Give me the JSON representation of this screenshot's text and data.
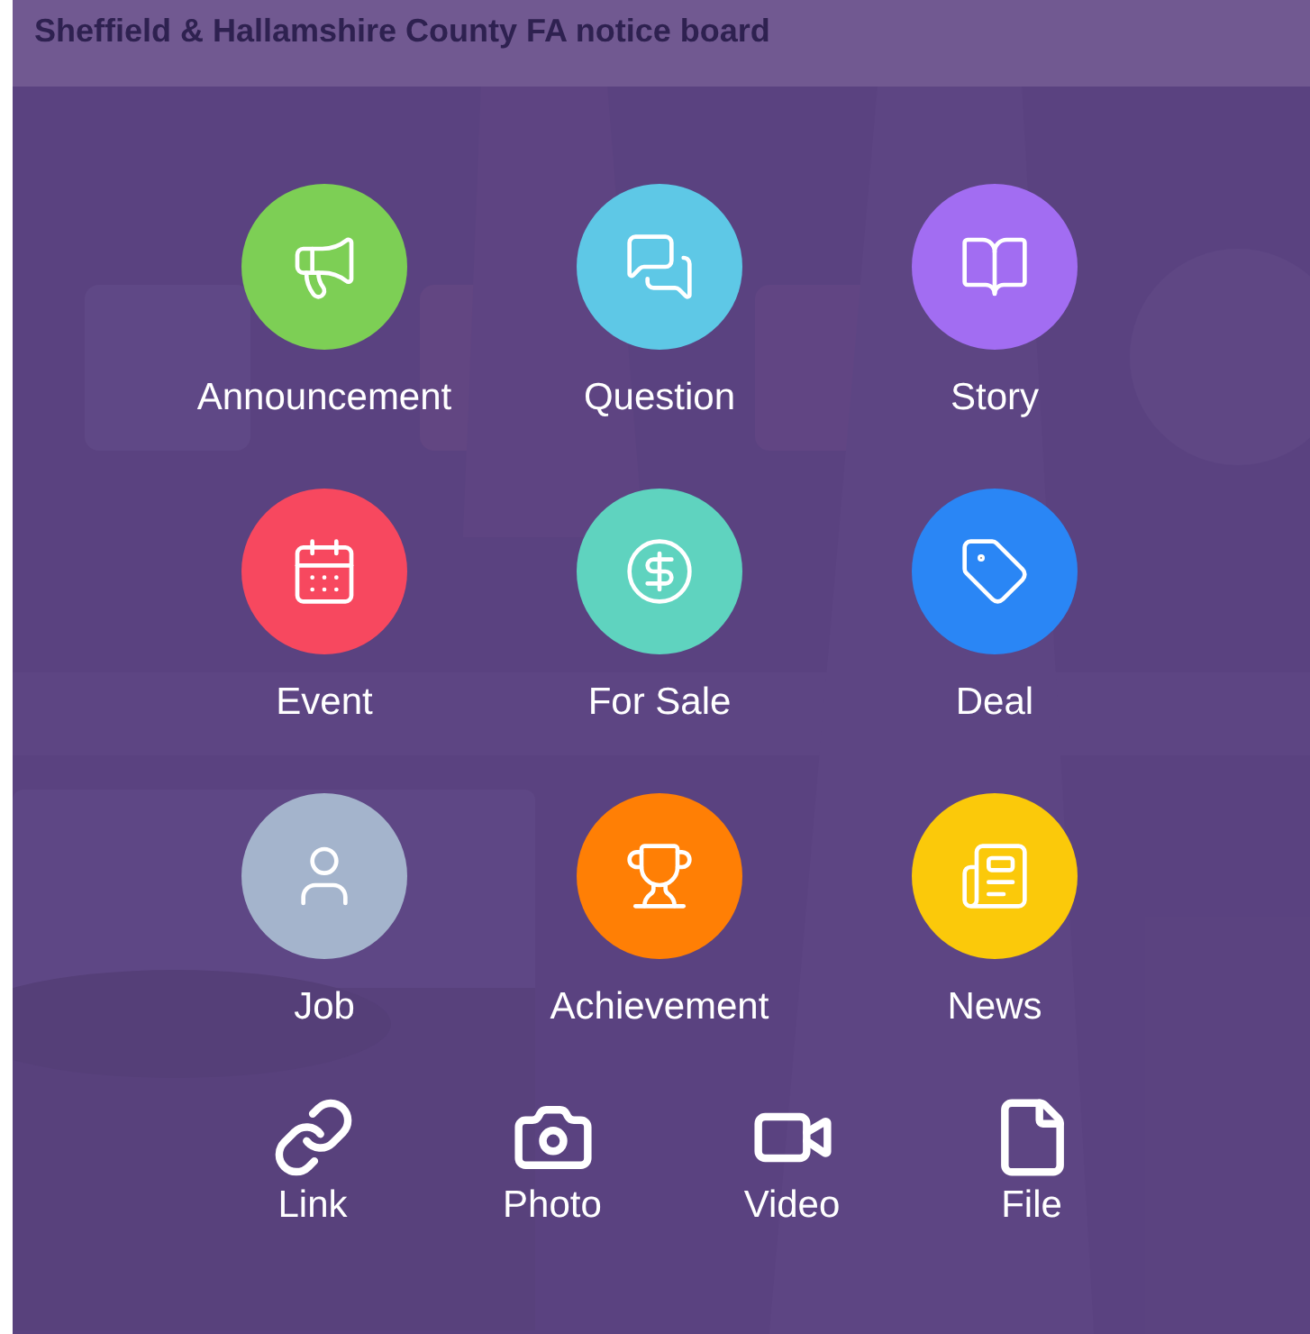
{
  "header": {
    "title": "Sheffield & Hallamshire County FA notice board"
  },
  "post_types": [
    {
      "label": "Announcement",
      "color": "#7dcf55"
    },
    {
      "label": "Question",
      "color": "#5ec8e6"
    },
    {
      "label": "Story",
      "color": "#a26df2"
    },
    {
      "label": "Event",
      "color": "#f7485f"
    },
    {
      "label": "For Sale",
      "color": "#5fd3bf"
    },
    {
      "label": "Deal",
      "color": "#2a86f5"
    },
    {
      "label": "Job",
      "color": "#a4b4cc"
    },
    {
      "label": "Achievement",
      "color": "#ff7f05"
    },
    {
      "label": "News",
      "color": "#fbc90a"
    }
  ],
  "attachments": [
    {
      "label": "Link"
    },
    {
      "label": "Photo"
    },
    {
      "label": "Video"
    },
    {
      "label": "File"
    }
  ]
}
